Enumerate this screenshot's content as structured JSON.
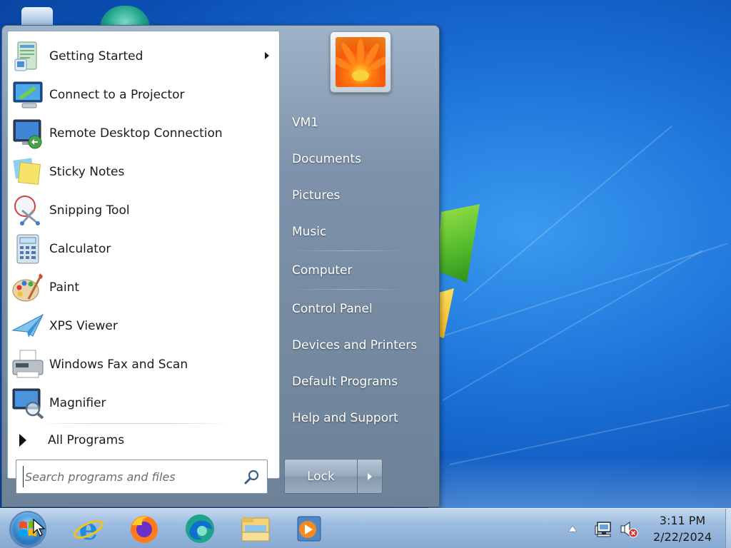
{
  "start_menu": {
    "programs": [
      {
        "label": "Getting Started",
        "icon": "getting-started-icon",
        "has_submenu": true
      },
      {
        "label": "Connect to a Projector",
        "icon": "projector-icon"
      },
      {
        "label": "Remote Desktop Connection",
        "icon": "remote-desktop-icon"
      },
      {
        "label": "Sticky Notes",
        "icon": "sticky-notes-icon"
      },
      {
        "label": "Snipping Tool",
        "icon": "snipping-tool-icon"
      },
      {
        "label": "Calculator",
        "icon": "calculator-icon"
      },
      {
        "label": "Paint",
        "icon": "paint-icon"
      },
      {
        "label": "XPS Viewer",
        "icon": "xps-viewer-icon"
      },
      {
        "label": "Windows Fax and Scan",
        "icon": "fax-scan-icon"
      },
      {
        "label": "Magnifier",
        "icon": "magnifier-icon"
      }
    ],
    "all_programs_label": "All Programs",
    "search": {
      "placeholder": "Search programs and files",
      "value": ""
    },
    "right_items": [
      {
        "label": "VM1"
      },
      {
        "label": "Documents"
      },
      {
        "label": "Pictures"
      },
      {
        "label": "Music"
      },
      {
        "label": "Computer"
      },
      {
        "label": "Control Panel"
      },
      {
        "label": "Devices and Printers"
      },
      {
        "label": "Default Programs"
      },
      {
        "label": "Help and Support"
      }
    ],
    "lock_label": "Lock"
  },
  "taskbar": {
    "apps": [
      {
        "icon": "internet-explorer-icon"
      },
      {
        "icon": "firefox-icon"
      },
      {
        "icon": "edge-icon"
      },
      {
        "icon": "windows-explorer-icon"
      },
      {
        "icon": "media-player-icon"
      }
    ],
    "tray": {
      "icons": [
        "show-hidden-icons-arrow",
        "network-icon",
        "volume-muted-icon"
      ]
    },
    "clock": {
      "time": "3:11 PM",
      "date": "2/22/2024"
    }
  },
  "colors": {
    "desktop": "#1a6fd6",
    "start_menu_right": "#7e93ab",
    "taskbar": "#9cbbe0"
  }
}
